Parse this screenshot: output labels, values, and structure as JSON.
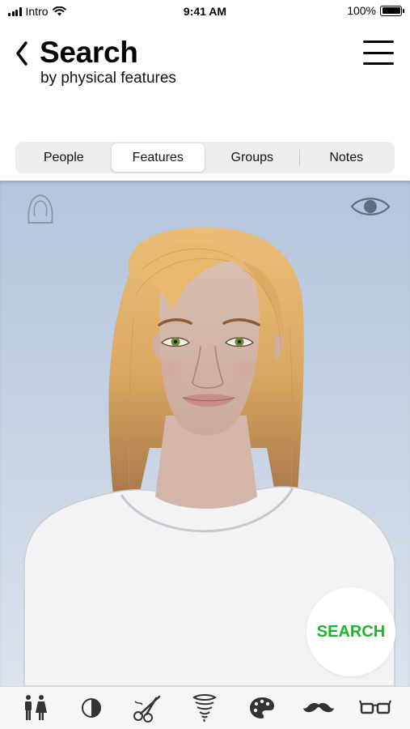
{
  "status_bar": {
    "carrier": "Intro",
    "time": "9:41 AM",
    "battery": "100%",
    "battery_level": 1.0
  },
  "header": {
    "back_icon": "chevron-left-icon",
    "title": "Search",
    "subtitle": "by physical features",
    "menu_icon": "hamburger-menu-icon"
  },
  "tabs": [
    {
      "label": "People",
      "active": false
    },
    {
      "label": "Features",
      "active": true
    },
    {
      "label": "Groups",
      "active": false
    },
    {
      "label": "Notes",
      "active": false
    }
  ],
  "stage": {
    "top_left_icon": "hijab-icon",
    "top_right_icon": "eye-icon",
    "search_label": "SEARCH",
    "search_color": "#1fb32b",
    "hair_color": "#e6b56e",
    "eye_color": "#6d8a3a",
    "shirt_color": "#f2f3f5"
  },
  "toolbar": {
    "items": [
      "gender-icon",
      "contrast-icon",
      "scissors-icon",
      "tornado-icon",
      "palette-icon",
      "mustache-icon",
      "glasses-icon"
    ]
  }
}
